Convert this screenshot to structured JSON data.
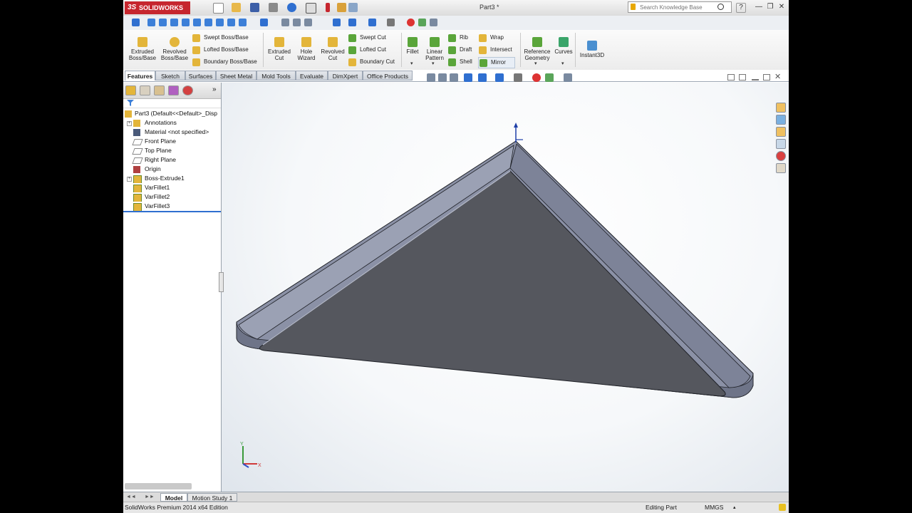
{
  "app": {
    "logo_text": "SOLIDWORKS",
    "logo_prefix": "3S"
  },
  "window": {
    "title": "Part3 *"
  },
  "search": {
    "placeholder": "Search Knowledge Base"
  },
  "window_controls": {
    "help": "?",
    "minimize": "—",
    "restore": "❐",
    "close": "✕"
  },
  "features_toolbar": {
    "extruded_boss": "Extruded Boss/Base",
    "revolved_boss": "Revolved Boss/Base",
    "swept_boss": "Swept Boss/Base",
    "lofted_boss": "Lofted Boss/Base",
    "boundary_boss": "Boundary Boss/Base",
    "extruded_cut": "Extruded Cut",
    "hole_wizard": "Hole Wizard",
    "revolved_cut": "Revolved Cut",
    "swept_cut": "Swept Cut",
    "lofted_cut": "Lofted Cut",
    "boundary_cut": "Boundary Cut",
    "fillet": "Fillet",
    "linear_pattern": "Linear Pattern",
    "rib": "Rib",
    "draft": "Draft",
    "shell": "Shell",
    "wrap": "Wrap",
    "intersect": "Intersect",
    "mirror": "Mirror",
    "reference_geometry": "Reference Geometry",
    "curves": "Curves",
    "instant3d": "Instant3D"
  },
  "tabs": [
    "Features",
    "Sketch",
    "Surfaces",
    "Sheet Metal",
    "Mold Tools",
    "Evaluate",
    "DimXpert",
    "Office Products"
  ],
  "panel": {
    "expand": "»"
  },
  "tree": [
    {
      "label": "Part3  (Default<<Default>_Disp",
      "icon": "part-icon",
      "expand": ""
    },
    {
      "label": "Annotations",
      "icon": "annotations-icon",
      "expand": "+"
    },
    {
      "label": "Material <not specified>",
      "icon": "material-icon",
      "expand": ""
    },
    {
      "label": "Front Plane",
      "icon": "plane-icon",
      "expand": ""
    },
    {
      "label": "Top Plane",
      "icon": "plane-icon",
      "expand": ""
    },
    {
      "label": "Right Plane",
      "icon": "plane-icon",
      "expand": ""
    },
    {
      "label": "Origin",
      "icon": "origin-icon",
      "expand": ""
    },
    {
      "label": "Boss-Extrude1",
      "icon": "extrude-icon",
      "expand": "+"
    },
    {
      "label": "VarFillet1",
      "icon": "fillet-icon",
      "expand": ""
    },
    {
      "label": "VarFillet2",
      "icon": "fillet-icon",
      "expand": ""
    },
    {
      "label": "VarFillet3",
      "icon": "fillet-icon",
      "expand": ""
    }
  ],
  "bottom_tabs": [
    "Model",
    "Motion Study 1"
  ],
  "status": {
    "edition": "SolidWorks Premium 2014 x64 Edition",
    "mode": "Editing Part",
    "units": "MMGS"
  },
  "triad": {
    "y": "Y",
    "x": "X"
  },
  "colors": {
    "brand": "#c6262e",
    "part_face": "#55575e",
    "part_edge": "#8b91a6",
    "rollback": "#2f6fd0"
  }
}
